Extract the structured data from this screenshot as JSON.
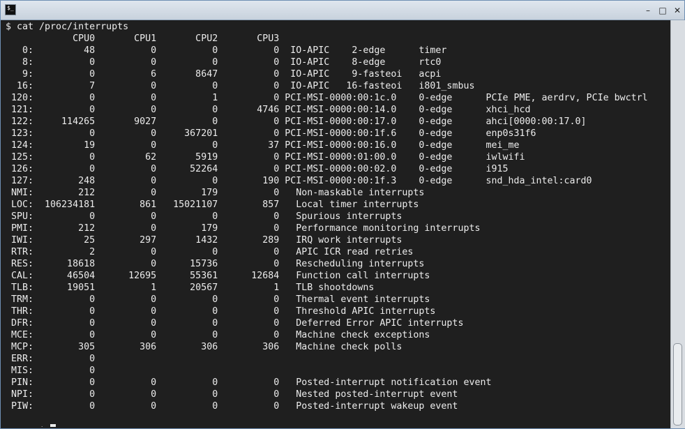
{
  "window": {
    "app_icon": "terminal-icon",
    "controls": {
      "minimize": "–",
      "maximize": "□",
      "close": "✕"
    }
  },
  "terminal": {
    "command_line": "$ cat /proc/interrupts",
    "prompt": "$ ",
    "lines": [
      "            CPU0       CPU1       CPU2       CPU3",
      "   0:         48          0          0          0  IO-APIC    2-edge      timer",
      "   8:          0          0          0          0  IO-APIC    8-edge      rtc0",
      "   9:          0          6       8647          0  IO-APIC    9-fasteoi   acpi",
      "  16:          7          0          0          0  IO-APIC   16-fasteoi   i801_smbus",
      " 120:          0          0          1          0 PCI-MSI-0000:00:1c.0    0-edge      PCIe PME, aerdrv, PCIe bwctrl",
      " 121:          0          0          0       4746 PCI-MSI-0000:00:14.0    0-edge      xhci_hcd",
      " 122:     114265       9027          0          0 PCI-MSI-0000:00:17.0    0-edge      ahci[0000:00:17.0]",
      " 123:          0          0     367201          0 PCI-MSI-0000:00:1f.6    0-edge      enp0s31f6",
      " 124:         19          0          0         37 PCI-MSI-0000:00:16.0    0-edge      mei_me",
      " 125:          0         62       5919          0 PCI-MSI-0000:01:00.0    0-edge      iwlwifi",
      " 126:          0          0      52264          0 PCI-MSI-0000:00:02.0    0-edge      i915",
      " 127:        248          0          0        190 PCI-MSI-0000:00:1f.3    0-edge      snd_hda_intel:card0",
      " NMI:        212          0        179          0   Non-maskable interrupts",
      " LOC:  106234181        861   15021107        857   Local timer interrupts",
      " SPU:          0          0          0          0   Spurious interrupts",
      " PMI:        212          0        179          0   Performance monitoring interrupts",
      " IWI:         25        297       1432        289   IRQ work interrupts",
      " RTR:          2          0          0          0   APIC ICR read retries",
      " RES:      18618          0      15736          0   Rescheduling interrupts",
      " CAL:      46504      12695      55361      12684   Function call interrupts",
      " TLB:      19051          1      20567          1   TLB shootdowns",
      " TRM:          0          0          0          0   Thermal event interrupts",
      " THR:          0          0          0          0   Threshold APIC interrupts",
      " DFR:          0          0          0          0   Deferred Error APIC interrupts",
      " MCE:          0          0          0          0   Machine check exceptions",
      " MCP:        305        306        306        306   Machine check polls",
      " ERR:          0",
      " MIS:          0",
      " PIN:          0          0          0          0   Posted-interrupt notification event",
      " NPI:          0          0          0          0   Nested posted-interrupt event",
      " PIW:          0          0          0          0   Posted-interrupt wakeup event"
    ]
  }
}
